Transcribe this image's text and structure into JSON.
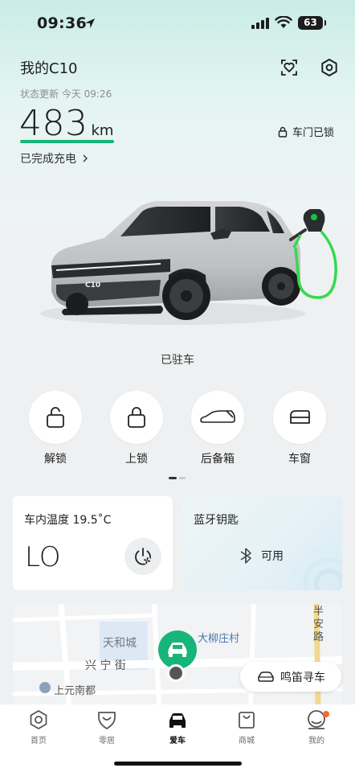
{
  "status_bar": {
    "time": "09:36",
    "battery": "63"
  },
  "header": {
    "car_name": "我的C10",
    "status_update": "状态更新 今天 09:26",
    "range_value": "483",
    "range_unit": "km",
    "charge_status": "已完成充电",
    "door_status": "车门已锁",
    "car_badge": "C10"
  },
  "parking_status": "已驻车",
  "controls": [
    {
      "label": "解锁",
      "icon": "unlock-icon"
    },
    {
      "label": "上锁",
      "icon": "lock-icon"
    },
    {
      "label": "后备箱",
      "icon": "trunk-icon"
    },
    {
      "label": "车窗",
      "icon": "window-icon"
    }
  ],
  "climate_card": {
    "title": "车内温度 19.5˚C",
    "value": "LO"
  },
  "bluetooth_card": {
    "title": "蓝牙钥匙",
    "status": "可用"
  },
  "map": {
    "labels": [
      "天和城",
      "大柳庄村",
      "兴 宁 街",
      "上元南都",
      "半安路"
    ],
    "honk_button": "鸣笛寻车"
  },
  "tabbar": [
    {
      "label": "首页",
      "icon": "hexagon-nut-icon",
      "active": false
    },
    {
      "label": "零居",
      "icon": "heart-shield-icon",
      "active": false
    },
    {
      "label": "爱车",
      "icon": "car-icon",
      "active": true
    },
    {
      "label": "商城",
      "icon": "shopping-bag-icon",
      "active": false
    },
    {
      "label": "我的",
      "icon": "user-icon",
      "active": false
    }
  ],
  "colors": {
    "accent": "#17b579",
    "badge": "#f26a2e"
  }
}
